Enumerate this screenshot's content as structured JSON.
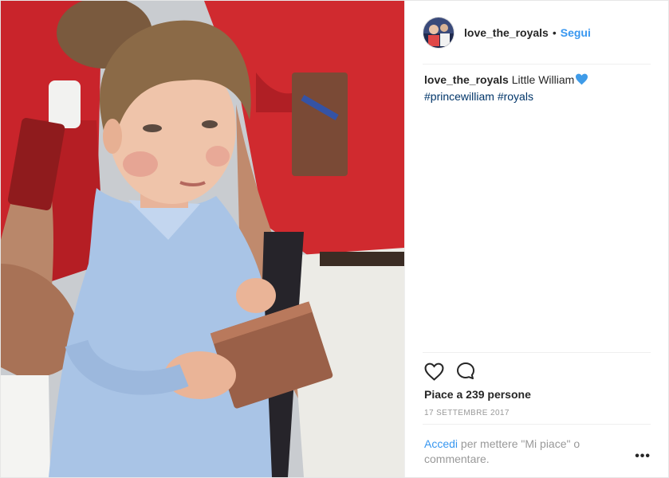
{
  "header": {
    "username": "love_the_royals",
    "separator": "•",
    "follow_label": "Segui"
  },
  "caption": {
    "username": "love_the_royals",
    "text": "Little William",
    "hashtags": [
      "#princewilliam",
      "#royals"
    ]
  },
  "actions": {
    "icons": [
      "heart-outline-icon",
      "comment-bubble-icon"
    ]
  },
  "likes": {
    "text": "Piace a 239 persone"
  },
  "date": "17 SETTEMBRE 2017",
  "login_prompt": {
    "link": "Accedi",
    "text": "per mettere \"Mi piace\" o commentare."
  },
  "more_label": "•••",
  "colors": {
    "link_blue": "#3897f0",
    "hashtag_blue": "#003569",
    "text": "#262626",
    "muted": "#999999",
    "heart_emoji": "#3f9be8"
  }
}
